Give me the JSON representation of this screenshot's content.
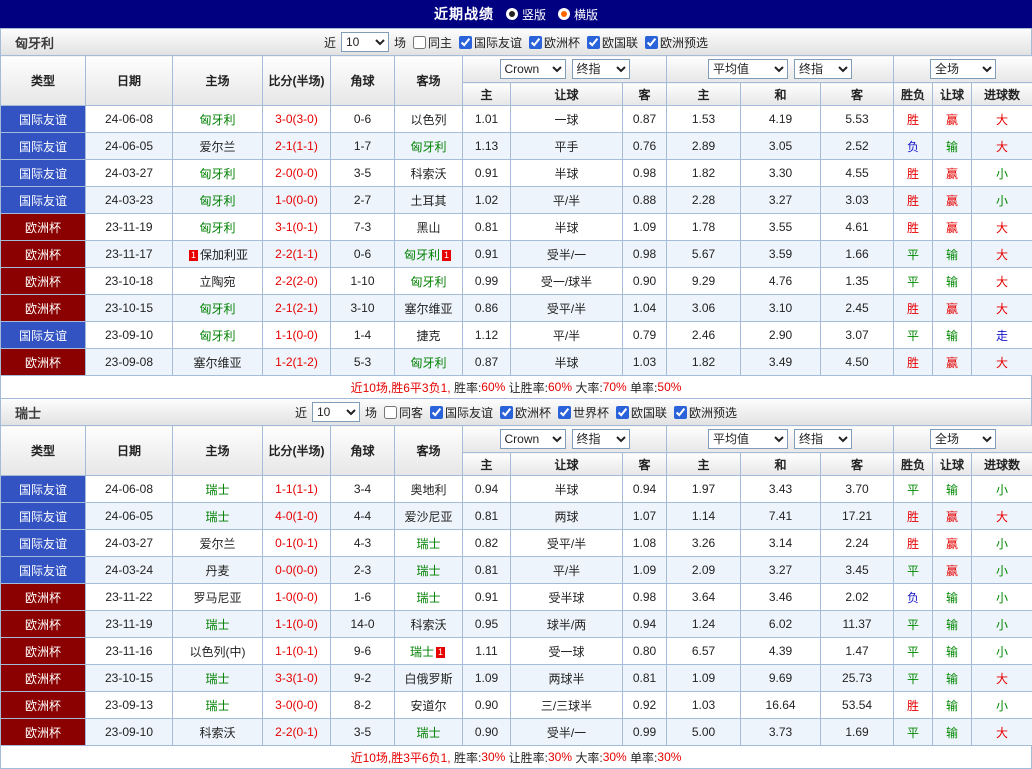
{
  "topbar": {
    "title": "近期战绩",
    "layout_options": [
      {
        "label": "竖版",
        "selected": true
      },
      {
        "label": "横版",
        "selected": false
      }
    ]
  },
  "colors": {
    "red": "#e60000",
    "dark": "#222222",
    "team_green": "#008000",
    "type_bg": {
      "国际友谊": "#3353c3",
      "欧洲杯": "#8b0000"
    },
    "result": {
      "胜": "#e60000",
      "赢": "#e60000",
      "大": "#e60000",
      "平": "#008800",
      "输": "#008800",
      "小": "#008800",
      "负": "#1414c8",
      "走": "#1414c8"
    }
  },
  "table_header": {
    "main_cols": [
      "类型",
      "日期",
      "主场",
      "比分(半场)",
      "角球",
      "客场"
    ],
    "group1_selects": [
      "Crown",
      "终指"
    ],
    "group2_selects": [
      "平均值",
      "终指"
    ],
    "group3_selects": [
      "全场"
    ],
    "sub_cols": [
      "主",
      "让球",
      "客",
      "主",
      "和",
      "客",
      "胜负",
      "让球",
      "进球数"
    ]
  },
  "sections": [
    {
      "team": "匈牙利",
      "filter": {
        "near_label": "近",
        "count": "10",
        "games_label": "场",
        "checkboxes": [
          {
            "label": "同主",
            "checked": false
          },
          {
            "label": "国际友谊",
            "checked": true
          },
          {
            "label": "欧洲杯",
            "checked": true
          },
          {
            "label": "欧国联",
            "checked": true
          },
          {
            "label": "欧洲预选",
            "checked": true
          }
        ]
      },
      "rows": [
        {
          "type": "国际友谊",
          "date": "24-06-08",
          "home": {
            "name": "匈牙利",
            "green": true
          },
          "score": "3-0(3-0)",
          "corner": "0-6",
          "away": {
            "name": "以色列"
          },
          "odds": [
            "1.01",
            "一球",
            "0.87"
          ],
          "europe": [
            "1.53",
            "4.19",
            "5.53"
          ],
          "results": [
            "胜",
            "赢",
            "大"
          ]
        },
        {
          "type": "国际友谊",
          "date": "24-06-05",
          "home": {
            "name": "爱尔兰"
          },
          "score": "2-1(1-1)",
          "corner": "1-7",
          "away": {
            "name": "匈牙利",
            "green": true
          },
          "odds": [
            "1.13",
            "平手",
            "0.76"
          ],
          "europe": [
            "2.89",
            "3.05",
            "2.52"
          ],
          "results": [
            "负",
            "输",
            "大"
          ]
        },
        {
          "type": "国际友谊",
          "date": "24-03-27",
          "home": {
            "name": "匈牙利",
            "green": true
          },
          "score": "2-0(0-0)",
          "corner": "3-5",
          "away": {
            "name": "科索沃"
          },
          "odds": [
            "0.91",
            "半球",
            "0.98"
          ],
          "europe": [
            "1.82",
            "3.30",
            "4.55"
          ],
          "results": [
            "胜",
            "赢",
            "小"
          ]
        },
        {
          "type": "国际友谊",
          "date": "24-03-23",
          "home": {
            "name": "匈牙利",
            "green": true
          },
          "score": "1-0(0-0)",
          "corner": "2-7",
          "away": {
            "name": "土耳其"
          },
          "odds": [
            "1.02",
            "平/半",
            "0.88"
          ],
          "europe": [
            "2.28",
            "3.27",
            "3.03"
          ],
          "results": [
            "胜",
            "赢",
            "小"
          ]
        },
        {
          "type": "欧洲杯",
          "date": "23-11-19",
          "home": {
            "name": "匈牙利",
            "green": true
          },
          "score": "3-1(0-1)",
          "corner": "7-3",
          "away": {
            "name": "黑山"
          },
          "odds": [
            "0.81",
            "半球",
            "1.09"
          ],
          "europe": [
            "1.78",
            "3.55",
            "4.61"
          ],
          "results": [
            "胜",
            "赢",
            "大"
          ]
        },
        {
          "type": "欧洲杯",
          "date": "23-11-17",
          "home": {
            "name": "保加利亚",
            "card": "1",
            "card_side": "left"
          },
          "score": "2-2(1-1)",
          "corner": "0-6",
          "away": {
            "name": "匈牙利",
            "green": true,
            "card": "1",
            "card_side": "right"
          },
          "odds": [
            "0.91",
            "受半/一",
            "0.98"
          ],
          "europe": [
            "5.67",
            "3.59",
            "1.66"
          ],
          "results": [
            "平",
            "输",
            "大"
          ]
        },
        {
          "type": "欧洲杯",
          "date": "23-10-18",
          "home": {
            "name": "立陶宛"
          },
          "score": "2-2(2-0)",
          "corner": "1-10",
          "away": {
            "name": "匈牙利",
            "green": true
          },
          "odds": [
            "0.99",
            "受一/球半",
            "0.90"
          ],
          "europe": [
            "9.29",
            "4.76",
            "1.35"
          ],
          "results": [
            "平",
            "输",
            "大"
          ]
        },
        {
          "type": "欧洲杯",
          "date": "23-10-15",
          "home": {
            "name": "匈牙利",
            "green": true
          },
          "score": "2-1(2-1)",
          "corner": "3-10",
          "away": {
            "name": "塞尔维亚"
          },
          "odds": [
            "0.86",
            "受平/半",
            "1.04"
          ],
          "europe": [
            "3.06",
            "3.10",
            "2.45"
          ],
          "results": [
            "胜",
            "赢",
            "大"
          ]
        },
        {
          "type": "国际友谊",
          "date": "23-09-10",
          "home": {
            "name": "匈牙利",
            "green": true
          },
          "score": "1-1(0-0)",
          "corner": "1-4",
          "away": {
            "name": "捷克"
          },
          "odds": [
            "1.12",
            "平/半",
            "0.79"
          ],
          "europe": [
            "2.46",
            "2.90",
            "3.07"
          ],
          "results": [
            "平",
            "输",
            "走"
          ]
        },
        {
          "type": "欧洲杯",
          "date": "23-09-08",
          "home": {
            "name": "塞尔维亚"
          },
          "score": "1-2(1-2)",
          "corner": "5-3",
          "away": {
            "name": "匈牙利",
            "green": true
          },
          "odds": [
            "0.87",
            "半球",
            "1.03"
          ],
          "europe": [
            "1.82",
            "3.49",
            "4.50"
          ],
          "results": [
            "胜",
            "赢",
            "大"
          ]
        }
      ],
      "summary": [
        {
          "text": "近10场,胜6平3负1, ",
          "c": "red"
        },
        {
          "text": "胜率:",
          "c": "dark"
        },
        {
          "text": "60%",
          "c": "red"
        },
        {
          "text": " 让胜率:",
          "c": "dark"
        },
        {
          "text": "60%",
          "c": "red"
        },
        {
          "text": " 大率:",
          "c": "dark"
        },
        {
          "text": "70%",
          "c": "red"
        },
        {
          "text": " 单率:",
          "c": "dark"
        },
        {
          "text": "50%",
          "c": "red"
        }
      ]
    },
    {
      "team": "瑞士",
      "filter": {
        "near_label": "近",
        "count": "10",
        "games_label": "场",
        "checkboxes": [
          {
            "label": "同客",
            "checked": false
          },
          {
            "label": "国际友谊",
            "checked": true
          },
          {
            "label": "欧洲杯",
            "checked": true
          },
          {
            "label": "世界杯",
            "checked": true
          },
          {
            "label": "欧国联",
            "checked": true
          },
          {
            "label": "欧洲预选",
            "checked": true
          }
        ]
      },
      "rows": [
        {
          "type": "国际友谊",
          "date": "24-06-08",
          "home": {
            "name": "瑞士",
            "green": true
          },
          "score": "1-1(1-1)",
          "corner": "3-4",
          "away": {
            "name": "奥地利"
          },
          "odds": [
            "0.94",
            "半球",
            "0.94"
          ],
          "europe": [
            "1.97",
            "3.43",
            "3.70"
          ],
          "results": [
            "平",
            "输",
            "小"
          ]
        },
        {
          "type": "国际友谊",
          "date": "24-06-05",
          "home": {
            "name": "瑞士",
            "green": true
          },
          "score": "4-0(1-0)",
          "corner": "4-4",
          "away": {
            "name": "爱沙尼亚"
          },
          "odds": [
            "0.81",
            "两球",
            "1.07"
          ],
          "europe": [
            "1.14",
            "7.41",
            "17.21"
          ],
          "results": [
            "胜",
            "赢",
            "大"
          ]
        },
        {
          "type": "国际友谊",
          "date": "24-03-27",
          "home": {
            "name": "爱尔兰"
          },
          "score": "0-1(0-1)",
          "corner": "4-3",
          "away": {
            "name": "瑞士",
            "green": true
          },
          "odds": [
            "0.82",
            "受平/半",
            "1.08"
          ],
          "europe": [
            "3.26",
            "3.14",
            "2.24"
          ],
          "results": [
            "胜",
            "赢",
            "小"
          ]
        },
        {
          "type": "国际友谊",
          "date": "24-03-24",
          "home": {
            "name": "丹麦"
          },
          "score": "0-0(0-0)",
          "corner": "2-3",
          "away": {
            "name": "瑞士",
            "green": true
          },
          "odds": [
            "0.81",
            "平/半",
            "1.09"
          ],
          "europe": [
            "2.09",
            "3.27",
            "3.45"
          ],
          "results": [
            "平",
            "赢",
            "小"
          ]
        },
        {
          "type": "欧洲杯",
          "date": "23-11-22",
          "home": {
            "name": "罗马尼亚"
          },
          "score": "1-0(0-0)",
          "corner": "1-6",
          "away": {
            "name": "瑞士",
            "green": true
          },
          "odds": [
            "0.91",
            "受半球",
            "0.98"
          ],
          "europe": [
            "3.64",
            "3.46",
            "2.02"
          ],
          "results": [
            "负",
            "输",
            "小"
          ]
        },
        {
          "type": "欧洲杯",
          "date": "23-11-19",
          "home": {
            "name": "瑞士",
            "green": true
          },
          "score": "1-1(0-0)",
          "corner": "14-0",
          "away": {
            "name": "科索沃"
          },
          "odds": [
            "0.95",
            "球半/两",
            "0.94"
          ],
          "europe": [
            "1.24",
            "6.02",
            "11.37"
          ],
          "results": [
            "平",
            "输",
            "小"
          ]
        },
        {
          "type": "欧洲杯",
          "date": "23-11-16",
          "home": {
            "name": "以色列(中)"
          },
          "score": "1-1(0-1)",
          "corner": "9-6",
          "away": {
            "name": "瑞士",
            "green": true,
            "card": "1",
            "card_side": "right"
          },
          "odds": [
            "1.11",
            "受一球",
            "0.80"
          ],
          "europe": [
            "6.57",
            "4.39",
            "1.47"
          ],
          "results": [
            "平",
            "输",
            "小"
          ]
        },
        {
          "type": "欧洲杯",
          "date": "23-10-15",
          "home": {
            "name": "瑞士",
            "green": true
          },
          "score": "3-3(1-0)",
          "corner": "9-2",
          "away": {
            "name": "白俄罗斯"
          },
          "odds": [
            "1.09",
            "两球半",
            "0.81"
          ],
          "europe": [
            "1.09",
            "9.69",
            "25.73"
          ],
          "results": [
            "平",
            "输",
            "大"
          ]
        },
        {
          "type": "欧洲杯",
          "date": "23-09-13",
          "home": {
            "name": "瑞士",
            "green": true
          },
          "score": "3-0(0-0)",
          "corner": "8-2",
          "away": {
            "name": "安道尔"
          },
          "odds": [
            "0.90",
            "三/三球半",
            "0.92"
          ],
          "europe": [
            "1.03",
            "16.64",
            "53.54"
          ],
          "results": [
            "胜",
            "输",
            "小"
          ]
        },
        {
          "type": "欧洲杯",
          "date": "23-09-10",
          "home": {
            "name": "科索沃"
          },
          "score": "2-2(0-1)",
          "corner": "3-5",
          "away": {
            "name": "瑞士",
            "green": true
          },
          "odds": [
            "0.90",
            "受半/一",
            "0.99"
          ],
          "europe": [
            "5.00",
            "3.73",
            "1.69"
          ],
          "results": [
            "平",
            "输",
            "大"
          ]
        }
      ],
      "summary": [
        {
          "text": "近10场,胜3平6负1, ",
          "c": "red"
        },
        {
          "text": "胜率:",
          "c": "dark"
        },
        {
          "text": "30%",
          "c": "red"
        },
        {
          "text": " 让胜率:",
          "c": "dark"
        },
        {
          "text": "30%",
          "c": "red"
        },
        {
          "text": " 大率:",
          "c": "dark"
        },
        {
          "text": "30%",
          "c": "red"
        },
        {
          "text": " 单率:",
          "c": "dark"
        },
        {
          "text": "30%",
          "c": "red"
        }
      ]
    }
  ]
}
